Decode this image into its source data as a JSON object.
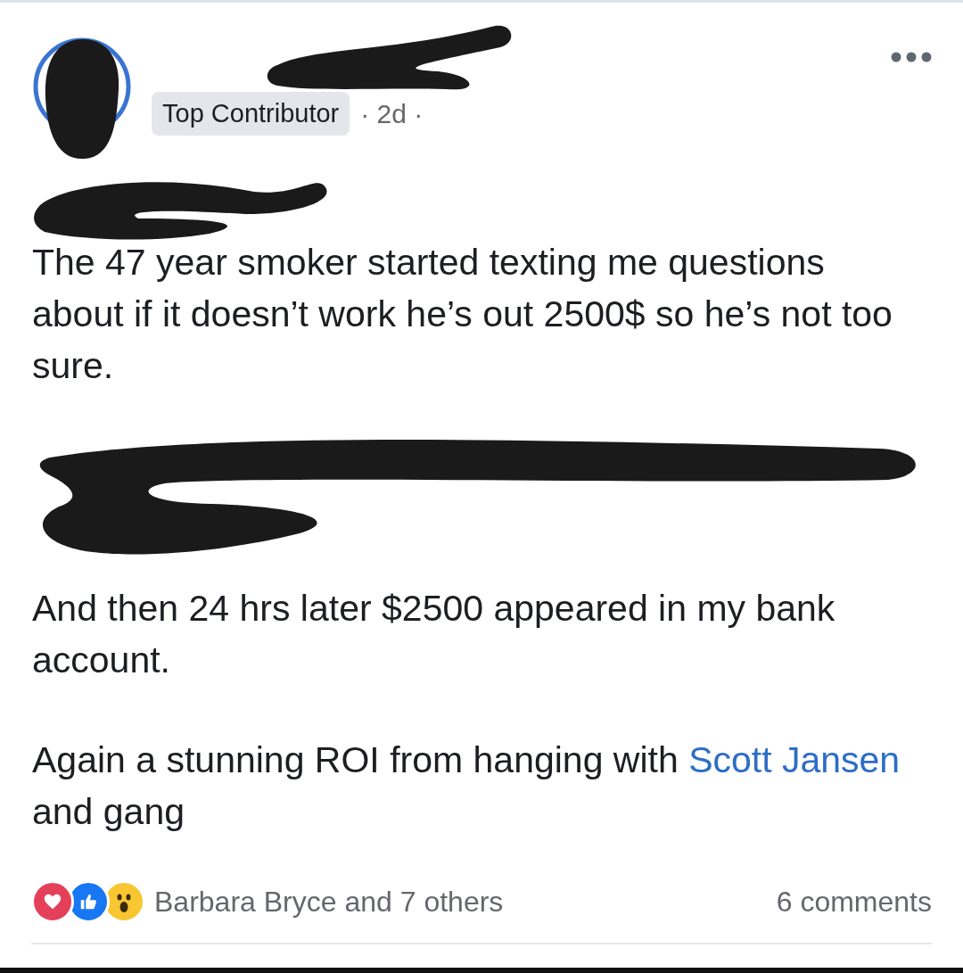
{
  "post": {
    "badge": "Top Contributor",
    "time": "· 2d ·",
    "paragraphs": [
      {
        "kind": "text",
        "text": "The 47 year smoker started texting me questions about if it doesn’t work he’s out 2500$ so he’s not too sure."
      },
      {
        "kind": "redacted"
      },
      {
        "kind": "text",
        "text": "And then 24 hrs later $2500 appeared in my bank account."
      },
      {
        "kind": "mention",
        "before": "Again a stunning ROI from hanging with ",
        "link": "Scott Jansen",
        "after": " and gang"
      }
    ],
    "reactions": [
      {
        "kind": "love",
        "color": "#e4405a"
      },
      {
        "kind": "like",
        "color": "#1877f2"
      },
      {
        "kind": "wow",
        "color": "#f7c631"
      }
    ],
    "reactors": "Barbara Bryce and 7 others",
    "comments": "6 comments"
  }
}
